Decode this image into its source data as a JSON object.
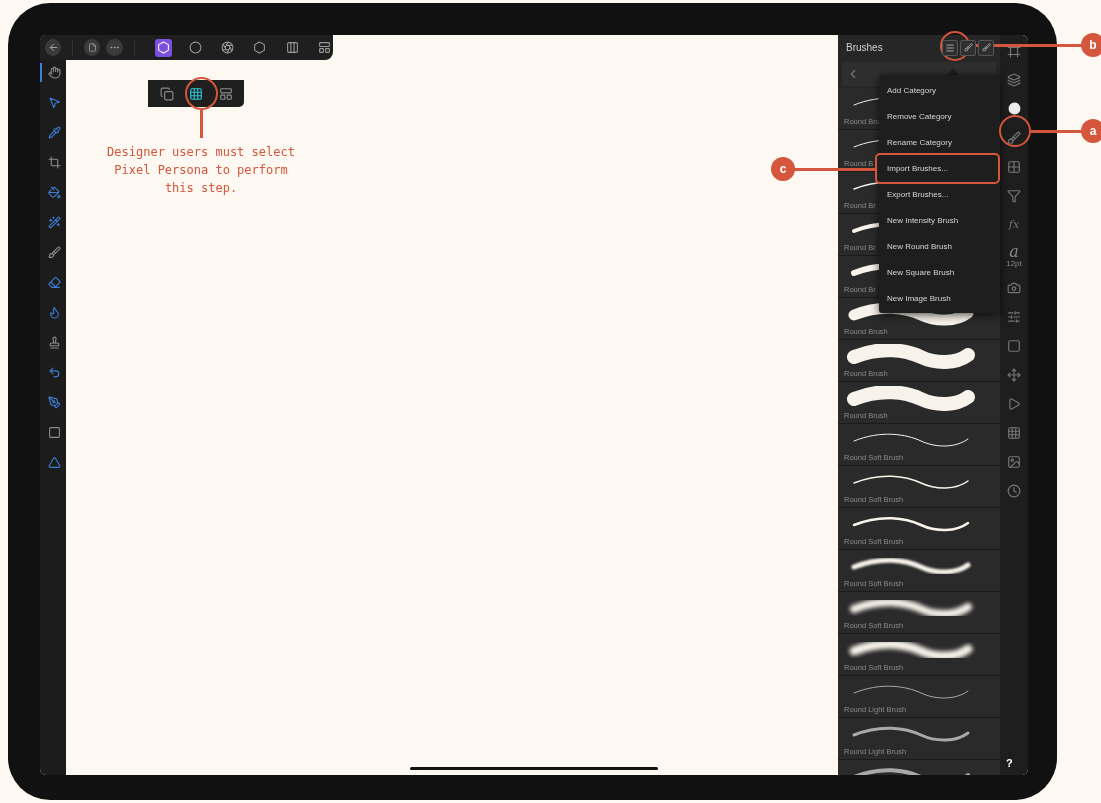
{
  "top_toolbar": {
    "personas": [
      {
        "selected": true
      },
      {
        "selected": false
      },
      {
        "selected": false
      },
      {
        "selected": false
      },
      {
        "selected": false
      },
      {
        "selected": false
      }
    ]
  },
  "persona_toolbar": {
    "items": [
      {
        "selected": false
      },
      {
        "selected": true
      },
      {
        "selected": false
      }
    ]
  },
  "tools": [
    {
      "selected": true
    },
    {
      "selected": false
    },
    {
      "selected": false
    },
    {
      "selected": false
    },
    {
      "selected": false
    },
    {
      "selected": false
    },
    {
      "selected": false
    },
    {
      "selected": false
    },
    {
      "selected": false
    },
    {
      "selected": false
    },
    {
      "selected": false
    },
    {
      "selected": false
    },
    {
      "selected": false
    },
    {
      "selected": false
    }
  ],
  "brushes_panel": {
    "title": "Brushes",
    "brushes": [
      {
        "label": "Round Bru",
        "kind": "round"
      },
      {
        "label": "Round B",
        "kind": "round"
      },
      {
        "label": "Round Br",
        "kind": "round"
      },
      {
        "label": "Round Br",
        "kind": "round"
      },
      {
        "label": "Round Br",
        "kind": "round"
      },
      {
        "label": "Round Brush",
        "kind": "round"
      },
      {
        "label": "Round Brush",
        "kind": "round"
      },
      {
        "label": "Round Brush",
        "kind": "round"
      },
      {
        "label": "Round Soft Brush",
        "kind": "soft"
      },
      {
        "label": "Round Soft Brush",
        "kind": "soft"
      },
      {
        "label": "Round Soft Brush",
        "kind": "soft"
      },
      {
        "label": "Round Soft Brush",
        "kind": "soft"
      },
      {
        "label": "Round Soft Brush",
        "kind": "soft"
      },
      {
        "label": "Round Soft Brush",
        "kind": "soft"
      },
      {
        "label": "Round Light Brush",
        "kind": "light"
      },
      {
        "label": "Round Light Brush",
        "kind": "light"
      },
      {
        "kind": "light"
      }
    ]
  },
  "menu": {
    "items": [
      "Add Category",
      "Remove Category",
      "Rename Category",
      "Import Brushes...",
      "Export Brushes...",
      "New Intensity Brush",
      "New Round Brush",
      "New Square Brush",
      "New Image Brush"
    ]
  },
  "studios": [
    {
      "kind": "icon"
    },
    {
      "kind": "icon"
    },
    {
      "kind": "icon"
    },
    {
      "kind": "icon"
    },
    {
      "kind": "icon"
    },
    {
      "kind": "icon"
    },
    {
      "kind": "glyph",
      "label": "fx"
    },
    {
      "kind": "text",
      "label": "a",
      "sub": "12pt"
    },
    {
      "kind": "icon"
    },
    {
      "kind": "icon"
    },
    {
      "kind": "icon"
    },
    {
      "kind": "icon"
    },
    {
      "kind": "icon"
    },
    {
      "kind": "icon"
    },
    {
      "kind": "icon"
    },
    {
      "kind": "icon"
    }
  ],
  "help": "?",
  "annotations": {
    "callouts": [
      "b",
      "a",
      "c"
    ],
    "note": "Designer users must select Pixel Persona to perform this step."
  }
}
